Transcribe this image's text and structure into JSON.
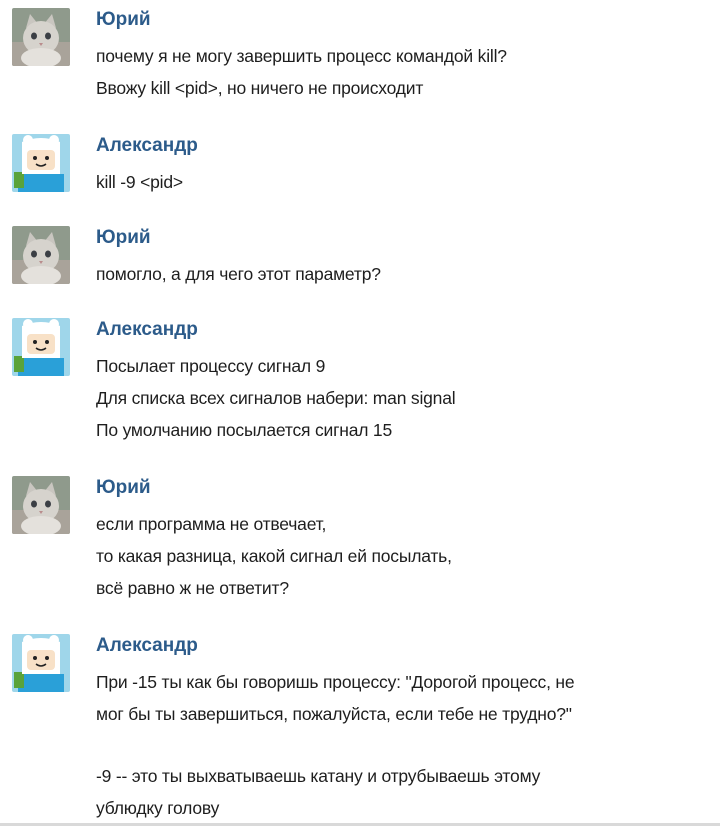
{
  "messages": [
    {
      "author": "Юрий",
      "avatar": "cat-avatar-icon",
      "lines": [
        "почему я не могу завершить процесс командой kill?",
        "Ввожу kill <pid>, но ничего не происходит"
      ]
    },
    {
      "author": "Александр",
      "avatar": "finn-avatar-icon",
      "lines": [
        "kill -9 <pid>"
      ]
    },
    {
      "author": "Юрий",
      "avatar": "cat-avatar-icon",
      "lines": [
        "помогло, а для чего этот параметр?"
      ]
    },
    {
      "author": "Александр",
      "avatar": "finn-avatar-icon",
      "lines": [
        "Посылает процессу сигнал 9",
        "Для списка всех сигналов набери: man signal",
        "По умолчанию посылается сигнал 15"
      ]
    },
    {
      "author": "Юрий",
      "avatar": "cat-avatar-icon",
      "lines": [
        "если программа не отвечает,",
        "то какая разница, какой сигнал ей посылать,",
        "всё равно ж не ответит?"
      ]
    },
    {
      "author": "Александр",
      "avatar": "finn-avatar-icon",
      "lines": [
        "При -15 ты как бы говоришь процессу: \"Дорогой процесс, не",
        "мог бы ты завершиться, пожалуйста, если тебе не трудно?\"",
        "",
        "-9 -- это ты выхватываешь катану и отрубываешь этому",
        "ублюдку голову"
      ]
    }
  ],
  "colors": {
    "author_name": "#2c5b8a",
    "message_text": "#1e1e1e"
  }
}
